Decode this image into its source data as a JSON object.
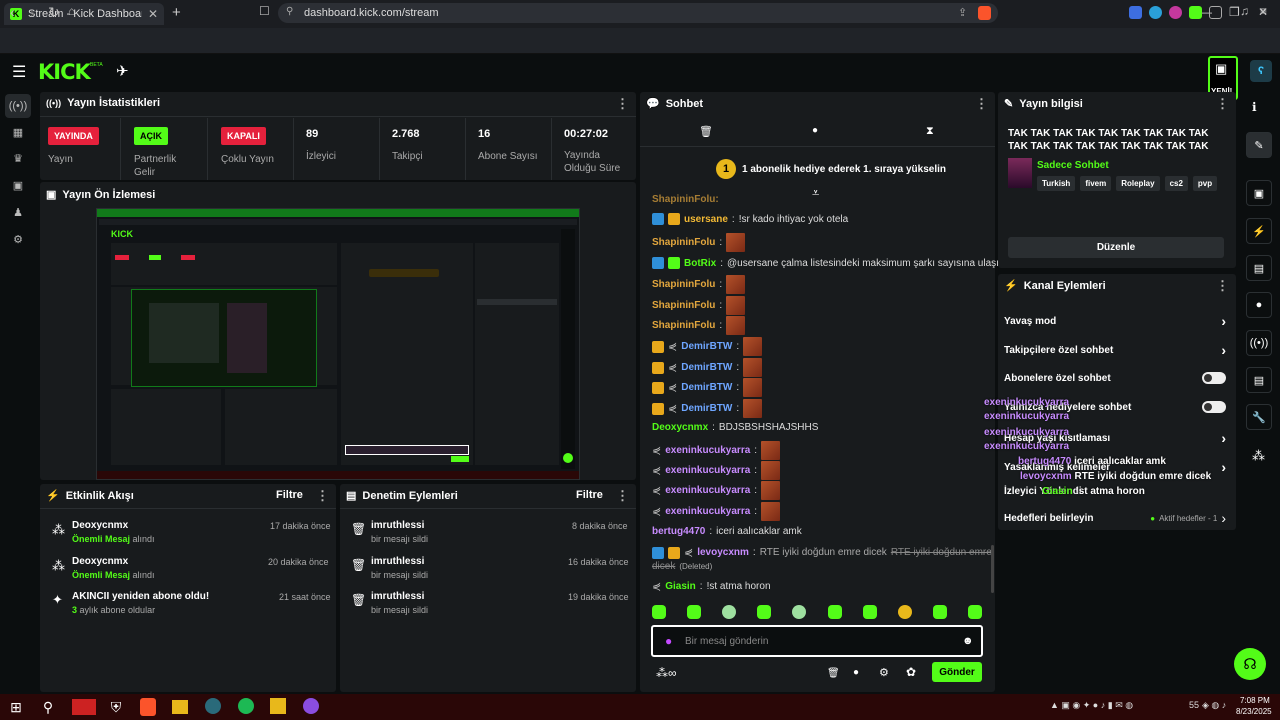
{
  "browser": {
    "tab_title": "Stream - Kick Dashboard",
    "url": "dashboard.kick.com/stream",
    "brave_count": "1"
  },
  "header": {
    "logo": "KICK",
    "beta": "BETA",
    "yeni_label": "YENİ!"
  },
  "stats_panel": {
    "title": "Yayın İstatistikleri",
    "items": [
      {
        "badge": "YAYINDA",
        "label": "Yayın",
        "color": "#e5213c"
      },
      {
        "badge": "AÇIK",
        "label": "Partnerlik Gelir",
        "color": "#53fc18"
      },
      {
        "badge": "KAPALI",
        "label": "Çoklu Yayın",
        "color": "#e5213c"
      },
      {
        "value": "89",
        "label": "İzleyici"
      },
      {
        "value": "2.768",
        "label": "Takipçi"
      },
      {
        "value": "16",
        "label": "Abone Sayısı"
      },
      {
        "value": "00:27:02",
        "label": "Yayında Olduğu Süre"
      }
    ]
  },
  "preview": {
    "title": "Yayın Ön İzlemesi"
  },
  "activity": {
    "title": "Etkinlik Akışı",
    "filter": "Filtre",
    "items": [
      {
        "user": "Deoxycnmx",
        "time": "17 dakika önce",
        "sub_hl": "Önemli Mesaj",
        "sub_rest": " alındı"
      },
      {
        "user": "Deoxycnmx",
        "time": "20 dakika önce",
        "sub_hl": "Önemli Mesaj",
        "sub_rest": " alındı"
      },
      {
        "user": "AKINCII yeniden abone oldu!",
        "time": "21 saat önce",
        "sub_hl": "3",
        "sub_rest": " aylık abone oldular"
      }
    ]
  },
  "moderation": {
    "title": "Denetim Eylemleri",
    "filter": "Filtre",
    "items": [
      {
        "user": "imruthlessi",
        "time": "8 dakika önce",
        "sub": "bir mesajı sildi"
      },
      {
        "user": "imruthlessi",
        "time": "16 dakika önce",
        "sub": "bir mesajı sildi"
      },
      {
        "user": "imruthlessi",
        "time": "19 dakika önce",
        "sub": "bir mesajı sildi"
      }
    ]
  },
  "chat": {
    "title": "Sohbet",
    "promo_num": "1",
    "promo_text": "1 abonelik hediye ederek 1. sıraya yükselin",
    "messages": [
      {
        "user": "usersane",
        "text": "!sr kado ihtiyac yok otela",
        "color": "#f2b935"
      },
      {
        "user": "ShapininFolu",
        "text": "",
        "color": "#e3a73e"
      },
      {
        "user": "BotRix",
        "text": "@usersane çalma listesindeki maksimum şarkı sayısına ulaşıldı.",
        "color": "#53fc18"
      },
      {
        "user": "ShapininFolu",
        "text": "",
        "color": "#e3a73e"
      },
      {
        "user": "ShapininFolu",
        "text": "",
        "color": "#e3a73e"
      },
      {
        "user": "DemirBTW",
        "text": "",
        "color": "#6ea6ff"
      },
      {
        "user": "DemirBTW",
        "text": "",
        "color": "#6ea6ff"
      },
      {
        "user": "DemirBTW",
        "text": "",
        "color": "#6ea6ff"
      },
      {
        "user": "DemirBTW",
        "text": "",
        "color": "#6ea6ff"
      },
      {
        "user": "Deoxycnmx",
        "text": "BDJSBSHSHAJSHHS",
        "color": "#53fc18"
      },
      {
        "user": "exeninkucukyarra",
        "text": "",
        "color": "#c88cff"
      },
      {
        "user": "exeninkucukyarra",
        "text": "",
        "color": "#c88cff"
      },
      {
        "user": "exeninkucukyarra",
        "text": "",
        "color": "#c88cff"
      },
      {
        "user": "exeninkucukyarra",
        "text": "",
        "color": "#c88cff"
      },
      {
        "user": "bertug4470",
        "text": "iceri aalıcaklar amk",
        "color": "#c88cff"
      },
      {
        "user": "levoycxnm",
        "text": "RTE iyiki doğdun emre dicek",
        "struck": "RTE iyiki doğdun emre",
        "cont": "dicek",
        "deleted": "(Deleted)",
        "color": "#c88cff"
      },
      {
        "user": "Giasin",
        "text": "!st atma horon",
        "color": "#53fc18"
      }
    ],
    "input_placeholder": "Bir mesaj gönderin",
    "send": "Gönder"
  },
  "stream_info": {
    "title": "Yayın bilgisi",
    "stream_title": "TAK TAK TAK TAK TAK TAK TAK TAK TAK TAK TAK TAK TAK TAK TAK TAK TAK TAK TA...",
    "category": "Sadece Sohbet",
    "tags": [
      "Turkish",
      "fivem",
      "Roleplay",
      "cs2",
      "pvp"
    ],
    "edit": "Düzenle"
  },
  "channel_actions": {
    "title": "Kanal Eylemleri",
    "rows": [
      "Yavaş mod",
      "Takipçilere özel sohbet",
      "Abonelere özel sohbet",
      "Yalnızca hediyelere sohbet",
      "Hesap yaşı kısıtlaması",
      "Yasaklanmış kelimeler",
      "İzleyici Yönlendi",
      "Hedefleri belirleyin"
    ],
    "goals_status": "Aktif hedefler - 1"
  },
  "overlay": [
    {
      "text": "exeninkucukyarra",
      "color": "#c88cff"
    },
    {
      "text": "exeninkucukyarra",
      "color": "#c88cff"
    },
    {
      "text": "exeninkucukyarra",
      "color": "#c88cff"
    },
    {
      "text": "exeninkucukyarra",
      "color": "#c88cff"
    },
    {
      "user": "bertug4470",
      "msg": "iceri aalıcaklar amk"
    },
    {
      "user": "levoycxnm",
      "msg": "RTE iyiki doğdun emre dicek"
    },
    {
      "user": "Giasin",
      "msg": "!st atma horon"
    }
  ],
  "taskbar": {
    "time": "7:08 PM",
    "date": "8/23/2025",
    "kbd": "55"
  },
  "colors": {
    "accent": "#53fc18",
    "live": "#e5213c"
  }
}
